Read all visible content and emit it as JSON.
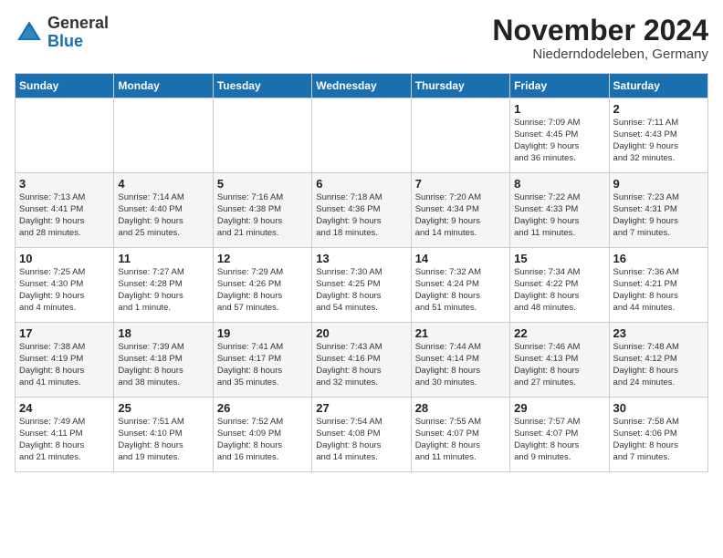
{
  "header": {
    "logo_general": "General",
    "logo_blue": "Blue",
    "month_title": "November 2024",
    "location": "Niederndodeleben, Germany"
  },
  "days_of_week": [
    "Sunday",
    "Monday",
    "Tuesday",
    "Wednesday",
    "Thursday",
    "Friday",
    "Saturday"
  ],
  "weeks": [
    [
      {
        "day": "",
        "info": ""
      },
      {
        "day": "",
        "info": ""
      },
      {
        "day": "",
        "info": ""
      },
      {
        "day": "",
        "info": ""
      },
      {
        "day": "",
        "info": ""
      },
      {
        "day": "1",
        "info": "Sunrise: 7:09 AM\nSunset: 4:45 PM\nDaylight: 9 hours\nand 36 minutes."
      },
      {
        "day": "2",
        "info": "Sunrise: 7:11 AM\nSunset: 4:43 PM\nDaylight: 9 hours\nand 32 minutes."
      }
    ],
    [
      {
        "day": "3",
        "info": "Sunrise: 7:13 AM\nSunset: 4:41 PM\nDaylight: 9 hours\nand 28 minutes."
      },
      {
        "day": "4",
        "info": "Sunrise: 7:14 AM\nSunset: 4:40 PM\nDaylight: 9 hours\nand 25 minutes."
      },
      {
        "day": "5",
        "info": "Sunrise: 7:16 AM\nSunset: 4:38 PM\nDaylight: 9 hours\nand 21 minutes."
      },
      {
        "day": "6",
        "info": "Sunrise: 7:18 AM\nSunset: 4:36 PM\nDaylight: 9 hours\nand 18 minutes."
      },
      {
        "day": "7",
        "info": "Sunrise: 7:20 AM\nSunset: 4:34 PM\nDaylight: 9 hours\nand 14 minutes."
      },
      {
        "day": "8",
        "info": "Sunrise: 7:22 AM\nSunset: 4:33 PM\nDaylight: 9 hours\nand 11 minutes."
      },
      {
        "day": "9",
        "info": "Sunrise: 7:23 AM\nSunset: 4:31 PM\nDaylight: 9 hours\nand 7 minutes."
      }
    ],
    [
      {
        "day": "10",
        "info": "Sunrise: 7:25 AM\nSunset: 4:30 PM\nDaylight: 9 hours\nand 4 minutes."
      },
      {
        "day": "11",
        "info": "Sunrise: 7:27 AM\nSunset: 4:28 PM\nDaylight: 9 hours\nand 1 minute."
      },
      {
        "day": "12",
        "info": "Sunrise: 7:29 AM\nSunset: 4:26 PM\nDaylight: 8 hours\nand 57 minutes."
      },
      {
        "day": "13",
        "info": "Sunrise: 7:30 AM\nSunset: 4:25 PM\nDaylight: 8 hours\nand 54 minutes."
      },
      {
        "day": "14",
        "info": "Sunrise: 7:32 AM\nSunset: 4:24 PM\nDaylight: 8 hours\nand 51 minutes."
      },
      {
        "day": "15",
        "info": "Sunrise: 7:34 AM\nSunset: 4:22 PM\nDaylight: 8 hours\nand 48 minutes."
      },
      {
        "day": "16",
        "info": "Sunrise: 7:36 AM\nSunset: 4:21 PM\nDaylight: 8 hours\nand 44 minutes."
      }
    ],
    [
      {
        "day": "17",
        "info": "Sunrise: 7:38 AM\nSunset: 4:19 PM\nDaylight: 8 hours\nand 41 minutes."
      },
      {
        "day": "18",
        "info": "Sunrise: 7:39 AM\nSunset: 4:18 PM\nDaylight: 8 hours\nand 38 minutes."
      },
      {
        "day": "19",
        "info": "Sunrise: 7:41 AM\nSunset: 4:17 PM\nDaylight: 8 hours\nand 35 minutes."
      },
      {
        "day": "20",
        "info": "Sunrise: 7:43 AM\nSunset: 4:16 PM\nDaylight: 8 hours\nand 32 minutes."
      },
      {
        "day": "21",
        "info": "Sunrise: 7:44 AM\nSunset: 4:14 PM\nDaylight: 8 hours\nand 30 minutes."
      },
      {
        "day": "22",
        "info": "Sunrise: 7:46 AM\nSunset: 4:13 PM\nDaylight: 8 hours\nand 27 minutes."
      },
      {
        "day": "23",
        "info": "Sunrise: 7:48 AM\nSunset: 4:12 PM\nDaylight: 8 hours\nand 24 minutes."
      }
    ],
    [
      {
        "day": "24",
        "info": "Sunrise: 7:49 AM\nSunset: 4:11 PM\nDaylight: 8 hours\nand 21 minutes."
      },
      {
        "day": "25",
        "info": "Sunrise: 7:51 AM\nSunset: 4:10 PM\nDaylight: 8 hours\nand 19 minutes."
      },
      {
        "day": "26",
        "info": "Sunrise: 7:52 AM\nSunset: 4:09 PM\nDaylight: 8 hours\nand 16 minutes."
      },
      {
        "day": "27",
        "info": "Sunrise: 7:54 AM\nSunset: 4:08 PM\nDaylight: 8 hours\nand 14 minutes."
      },
      {
        "day": "28",
        "info": "Sunrise: 7:55 AM\nSunset: 4:07 PM\nDaylight: 8 hours\nand 11 minutes."
      },
      {
        "day": "29",
        "info": "Sunrise: 7:57 AM\nSunset: 4:07 PM\nDaylight: 8 hours\nand 9 minutes."
      },
      {
        "day": "30",
        "info": "Sunrise: 7:58 AM\nSunset: 4:06 PM\nDaylight: 8 hours\nand 7 minutes."
      }
    ]
  ]
}
